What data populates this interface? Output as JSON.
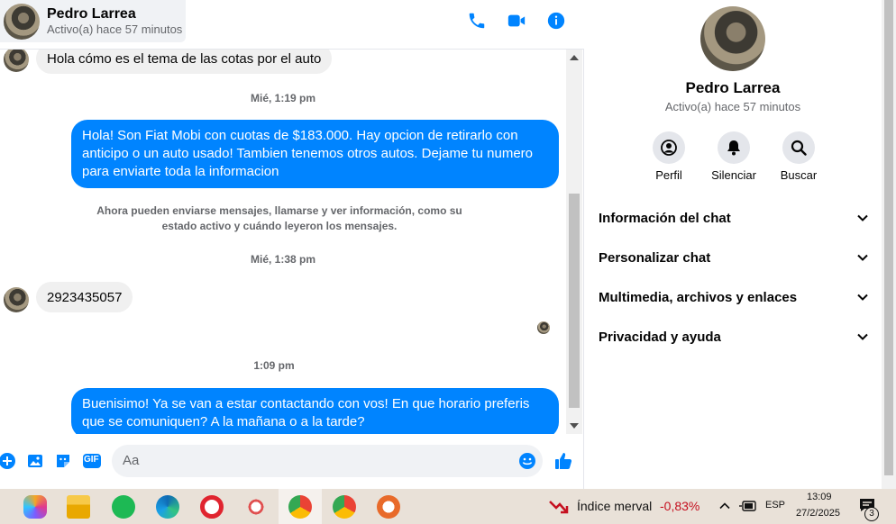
{
  "header": {
    "name": "Pedro Larrea",
    "status": "Activo(a) hace 57 minutos"
  },
  "messages": {
    "m1": "Hola cómo es el tema de las cotas por el auto",
    "ts1": "Mié, 1:19 pm",
    "m2": "Hola! Son Fiat Mobi con cuotas de $183.000. Hay opcion de retirarlo con anticipo o un auto usado! Tambien tenemos otros autos. Dejame tu numero para enviarte toda la informacion",
    "sys": "Ahora pueden enviarse mensajes, llamarse y ver información, como su estado activo y cuándo leyeron los mensajes.",
    "ts2": "Mié, 1:38 pm",
    "m3": "2923435057",
    "ts3": "1:09 pm",
    "m4": "Buenisimo! Ya se van a estar contactando con vos! En que horario preferis que se comuniquen? A la mañana o a la tarde?"
  },
  "composer": {
    "placeholder": "Aa",
    "gif_label": "GIF"
  },
  "info": {
    "name": "Pedro Larrea",
    "status": "Activo(a) hace 57 minutos",
    "actions": [
      "Perfil",
      "Silenciar",
      "Buscar"
    ],
    "sections": [
      "Información del chat",
      "Personalizar chat",
      "Multimedia, archivos y enlaces",
      "Privacidad y ayuda"
    ]
  },
  "taskbar": {
    "stock_name": "Índice merval",
    "stock_change": "-0,83%",
    "language": "ESP",
    "time": "13:09",
    "date": "27/2/2025",
    "notifications": "3"
  },
  "colors": {
    "accent": "#0084ff",
    "negative": "#c50f1f"
  }
}
